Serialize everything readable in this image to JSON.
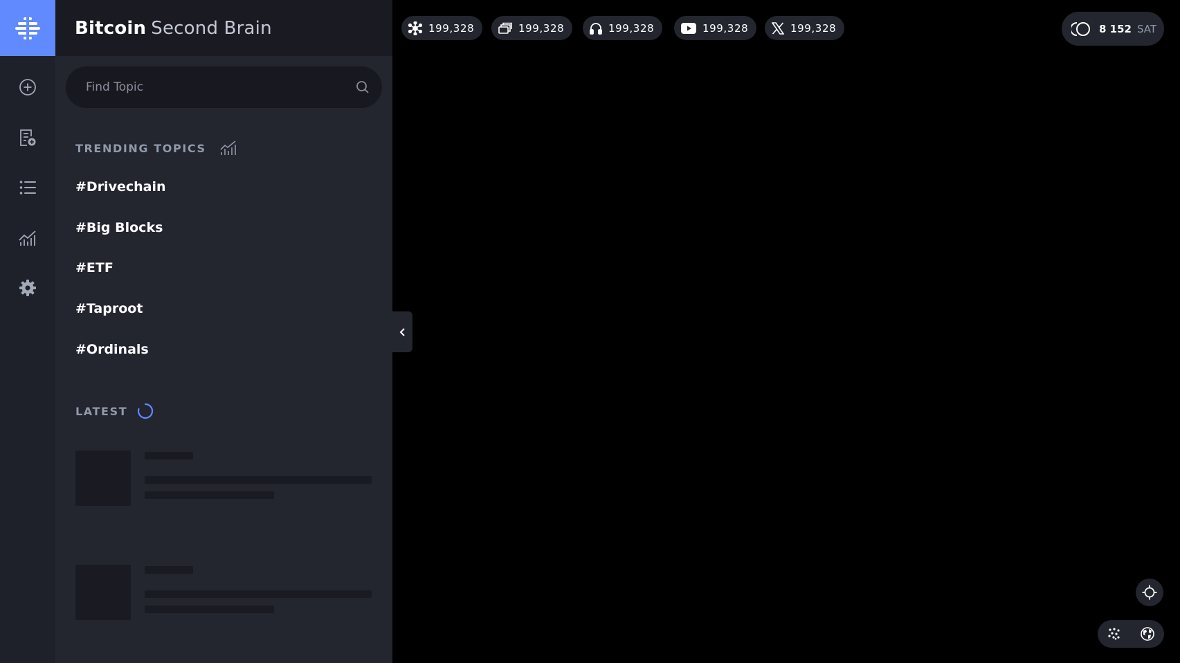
{
  "app": {
    "brand_strong": "Bitcoin",
    "brand_light": "Second Brain"
  },
  "rail": {
    "items": [
      {
        "icon": "add-circle-icon"
      },
      {
        "icon": "add-source-icon"
      },
      {
        "icon": "list-icon"
      },
      {
        "icon": "chart-icon"
      },
      {
        "icon": "gear-icon"
      }
    ]
  },
  "search": {
    "placeholder": "Find Topic",
    "value": ""
  },
  "trending": {
    "title": "TRENDING TOPICS",
    "topics": [
      "#Drivechain",
      "#Big Blocks",
      "#ETF",
      "#Taproot",
      "#Ordinals"
    ]
  },
  "latest": {
    "title": "LATEST"
  },
  "stats": [
    {
      "icon": "nodes-icon",
      "value": "199,328"
    },
    {
      "icon": "episodes-icon",
      "value": "199,328"
    },
    {
      "icon": "podcast-icon",
      "value": "199,328"
    },
    {
      "icon": "youtube-icon",
      "value": "199,328"
    },
    {
      "icon": "x-icon",
      "value": "199,328"
    }
  ],
  "balance": {
    "value": "8 152",
    "unit": "SAT"
  },
  "colors": {
    "accent": "#618aff",
    "rail_bg": "#1f212a",
    "panel_bg": "#23252f",
    "canvas_bg": "#000000"
  }
}
